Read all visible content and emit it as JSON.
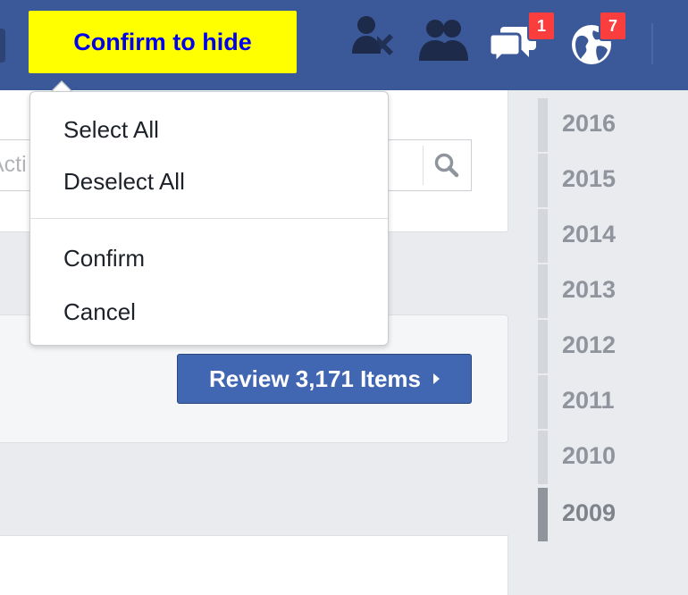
{
  "topbar": {
    "confirm_hide_label": "Confirm to hide",
    "icons": [
      "friend-requests-icon",
      "friends-icon",
      "messages-icon",
      "notifications-globe-icon"
    ],
    "messages_badge": "1",
    "notifications_badge": "7",
    "background_color": "#3b5998",
    "highlight_color": "#ffff00"
  },
  "dropdown": {
    "items": [
      {
        "label": "Select All"
      },
      {
        "label": "Deselect All"
      },
      {
        "label": "Confirm"
      },
      {
        "label": "Cancel"
      }
    ]
  },
  "search": {
    "placeholder_partial": "Acti",
    "icon": "search-icon"
  },
  "review": {
    "button_label": "Review 3,171 Items",
    "icon": "chevron-right-icon",
    "button_color": "#4267b2"
  },
  "timeline": {
    "years": [
      {
        "label": "2016"
      },
      {
        "label": "2015"
      },
      {
        "label": "2014"
      },
      {
        "label": "2013"
      },
      {
        "label": "2012"
      },
      {
        "label": "2011"
      },
      {
        "label": "2010"
      },
      {
        "label": "2009",
        "active": true
      }
    ]
  }
}
